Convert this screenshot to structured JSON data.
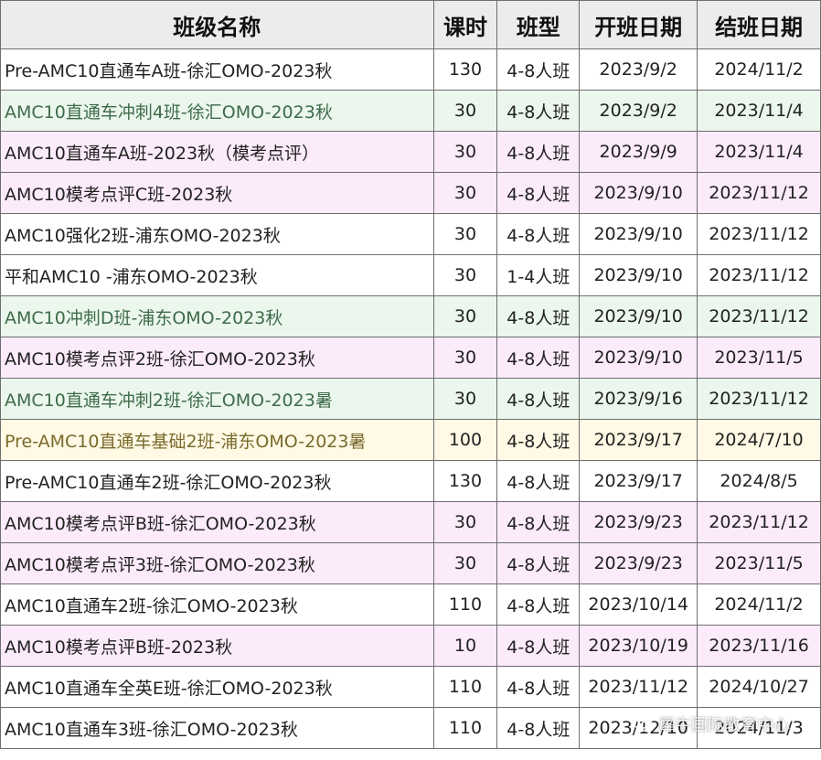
{
  "headers": {
    "name": "班级名称",
    "hours": "课时",
    "type": "班型",
    "start": "开班日期",
    "end": "结班日期"
  },
  "colors": {
    "white": "#ffffff",
    "green": "#ebf6ec",
    "pink": "#fcebfb",
    "yellow": "#fff9e5",
    "green_text": "#3e6b49",
    "yellow_text": "#7a6a2c",
    "default_text": "#222222"
  },
  "rows": [
    {
      "name": "Pre-AMC10直通车A班-徐汇OMO-2023秋",
      "hours": "130",
      "type": "4-8人班",
      "start": "2023/9/2",
      "end": "2024/11/2",
      "bg": "white"
    },
    {
      "name": "AMC10直通车冲刺4班-徐汇OMO-2023秋",
      "hours": "30",
      "type": "4-8人班",
      "start": "2023/9/2",
      "end": "2023/11/4",
      "bg": "green"
    },
    {
      "name": "AMC10直通车A班-2023秋（模考点评）",
      "hours": "30",
      "type": "4-8人班",
      "start": "2023/9/9",
      "end": "2023/11/4",
      "bg": "pink"
    },
    {
      "name": "AMC10模考点评C班-2023秋",
      "hours": "30",
      "type": "4-8人班",
      "start": "2023/9/10",
      "end": "2023/11/12",
      "bg": "pink"
    },
    {
      "name": "AMC10强化2班-浦东OMO-2023秋",
      "hours": "30",
      "type": "4-8人班",
      "start": "2023/9/10",
      "end": "2023/11/12",
      "bg": "white"
    },
    {
      "name": "平和AMC10 -浦东OMO-2023秋",
      "hours": "30",
      "type": "1-4人班",
      "start": "2023/9/10",
      "end": "2023/11/12",
      "bg": "white"
    },
    {
      "name": "AMC10冲刺D班-浦东OMO-2023秋",
      "hours": "30",
      "type": "4-8人班",
      "start": "2023/9/10",
      "end": "2023/11/12",
      "bg": "green"
    },
    {
      "name": "AMC10模考点评2班-徐汇OMO-2023秋",
      "hours": "30",
      "type": "4-8人班",
      "start": "2023/9/10",
      "end": "2023/11/5",
      "bg": "pink"
    },
    {
      "name": "AMC10直通车冲刺2班-徐汇OMO-2023暑",
      "hours": "30",
      "type": "4-8人班",
      "start": "2023/9/16",
      "end": "2023/11/12",
      "bg": "green"
    },
    {
      "name": "Pre-AMC10直通车基础2班-浦东OMO-2023暑",
      "hours": "100",
      "type": "4-8人班",
      "start": "2023/9/17",
      "end": "2024/7/10",
      "bg": "yellow"
    },
    {
      "name": "Pre-AMC10直通车2班-徐汇OMO-2023秋",
      "hours": "130",
      "type": "4-8人班",
      "start": "2023/9/17",
      "end": "2024/8/5",
      "bg": "white"
    },
    {
      "name": "AMC10模考点评B班-徐汇OMO-2023秋",
      "hours": "30",
      "type": "4-8人班",
      "start": "2023/9/23",
      "end": "2023/11/12",
      "bg": "pink"
    },
    {
      "name": "AMC10模考点评3班-徐汇OMO-2023秋",
      "hours": "30",
      "type": "4-8人班",
      "start": "2023/9/23",
      "end": "2023/11/5",
      "bg": "pink"
    },
    {
      "name": "AMC10直通车2班-徐汇OMO-2023秋",
      "hours": "110",
      "type": "4-8人班",
      "start": "2023/10/14",
      "end": "2024/11/2",
      "bg": "white"
    },
    {
      "name": "AMC10模考点评B班-2023秋",
      "hours": "10",
      "type": "4-8人班",
      "start": "2023/10/19",
      "end": "2023/11/16",
      "bg": "pink"
    },
    {
      "name": "AMC10直通车全英E班-徐汇OMO-2023秋",
      "hours": "110",
      "type": "4-8人班",
      "start": "2023/11/12",
      "end": "2024/10/27",
      "bg": "white"
    },
    {
      "name": "AMC10直通车3班-徐汇OMO-2023秋",
      "hours": "110",
      "type": "4-8人班",
      "start": "2023/12/10",
      "end": "2024/11/3",
      "bg": "white"
    }
  ],
  "watermark": {
    "icon": "wechat-icon",
    "text": "犀牛国际教育中心"
  }
}
